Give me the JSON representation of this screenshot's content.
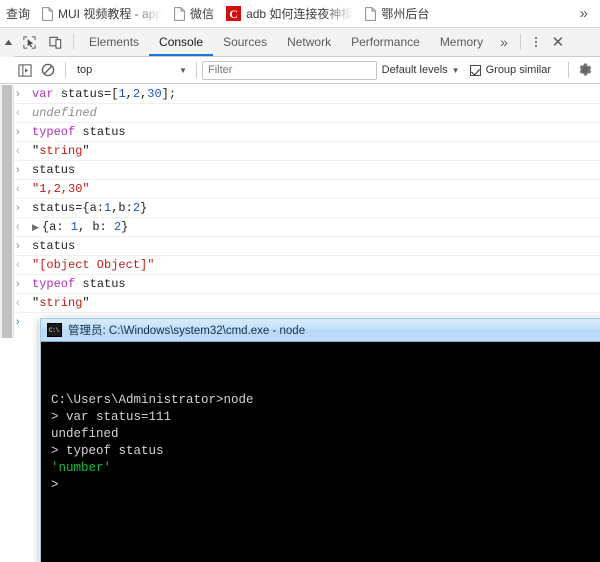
{
  "bookmarks_bar": {
    "items": [
      {
        "label": "查询",
        "icon": "none",
        "clipped": false
      },
      {
        "label": "MUI 视频教程 - app",
        "icon": "page-icon",
        "clipped": true
      },
      {
        "label": "微信",
        "icon": "page-icon",
        "clipped": false
      },
      {
        "label": "adb 如何连接夜神模",
        "icon": "c-letter-icon",
        "clipped": true
      },
      {
        "label": "鄂州后台",
        "icon": "page-icon",
        "clipped": false
      }
    ],
    "overflow_label": "»"
  },
  "devtools": {
    "toolbar": {
      "collapse_label": "▲",
      "inspect_icon": "inspect-element-icon",
      "device_icon": "device-toolbar-icon",
      "tabs": [
        {
          "label": "Elements",
          "active": false
        },
        {
          "label": "Console",
          "active": true
        },
        {
          "label": "Sources",
          "active": false
        },
        {
          "label": "Network",
          "active": false
        },
        {
          "label": "Performance",
          "active": false
        },
        {
          "label": "Memory",
          "active": false
        }
      ],
      "more_tabs_label": "»",
      "kebab_icon": "more-options-icon",
      "close_label": "✕"
    },
    "filterbar": {
      "sidebar_icon": "console-sidebar-icon",
      "clear_icon": "clear-console-icon",
      "context_value": "top",
      "context_caret": "▼",
      "filter_placeholder": "Filter",
      "filter_value": "",
      "levels_label": "Default levels",
      "levels_caret": "▼",
      "group_similar_label": "Group similar",
      "group_similar_checked": true,
      "settings_icon": "gear-icon"
    },
    "console_rows": [
      {
        "kind": "input",
        "marker": "›",
        "segments": [
          {
            "text": "var ",
            "style": "kw"
          },
          {
            "text": "status",
            "style": "plain"
          },
          {
            "text": "=[",
            "style": "plain"
          },
          {
            "text": "1",
            "style": "num"
          },
          {
            "text": ",",
            "style": "plain"
          },
          {
            "text": "2",
            "style": "num"
          },
          {
            "text": ",",
            "style": "plain"
          },
          {
            "text": "30",
            "style": "num"
          },
          {
            "text": "];",
            "style": "plain"
          }
        ]
      },
      {
        "kind": "output",
        "marker": "‹",
        "segments": [
          {
            "text": "undefined",
            "style": "undef"
          }
        ]
      },
      {
        "kind": "input",
        "marker": "›",
        "segments": [
          {
            "text": "typeof ",
            "style": "kw"
          },
          {
            "text": "status",
            "style": "plain"
          }
        ]
      },
      {
        "kind": "output",
        "marker": "‹",
        "segments": [
          {
            "text": "\"",
            "style": "plain"
          },
          {
            "text": "string",
            "style": "str"
          },
          {
            "text": "\"",
            "style": "plain"
          }
        ]
      },
      {
        "kind": "input",
        "marker": "›",
        "segments": [
          {
            "text": "status",
            "style": "plain"
          }
        ]
      },
      {
        "kind": "output",
        "marker": "‹",
        "segments": [
          {
            "text": "\"1,2,30\"",
            "style": "str"
          }
        ]
      },
      {
        "kind": "input",
        "marker": "›",
        "segments": [
          {
            "text": "status={a:",
            "style": "plain"
          },
          {
            "text": "1",
            "style": "num"
          },
          {
            "text": ",b:",
            "style": "plain"
          },
          {
            "text": "2",
            "style": "num"
          },
          {
            "text": "}",
            "style": "plain"
          }
        ]
      },
      {
        "kind": "output",
        "marker": "‹",
        "disclosure": "▶",
        "segments": [
          {
            "text": "{a: ",
            "style": "obj"
          },
          {
            "text": "1",
            "style": "num"
          },
          {
            "text": ", b: ",
            "style": "obj"
          },
          {
            "text": "2",
            "style": "num"
          },
          {
            "text": "}",
            "style": "obj"
          }
        ]
      },
      {
        "kind": "input",
        "marker": "›",
        "segments": [
          {
            "text": "status",
            "style": "plain"
          }
        ]
      },
      {
        "kind": "output",
        "marker": "‹",
        "segments": [
          {
            "text": "\"[object Object]\"",
            "style": "str"
          }
        ]
      },
      {
        "kind": "input",
        "marker": "›",
        "segments": [
          {
            "text": "typeof ",
            "style": "kw"
          },
          {
            "text": "status",
            "style": "plain"
          }
        ]
      },
      {
        "kind": "output",
        "marker": "‹",
        "segments": [
          {
            "text": "\"",
            "style": "plain"
          },
          {
            "text": "string",
            "style": "str"
          },
          {
            "text": "\"",
            "style": "plain"
          }
        ]
      }
    ],
    "prompt": {
      "caret": "›",
      "value": ""
    }
  },
  "cmd_window": {
    "title": "管理员: C:\\Windows\\system32\\cmd.exe - node",
    "icon": "cmd-console-icon",
    "lines": [
      {
        "text": "C:\\Users\\Administrator>node",
        "color": "white"
      },
      {
        "text": "> var status=111",
        "color": "white"
      },
      {
        "text": "undefined",
        "color": "white"
      },
      {
        "text": "> typeof status",
        "color": "white"
      },
      {
        "text": "'number'",
        "color": "green"
      },
      {
        "text": ">",
        "color": "white"
      }
    ]
  },
  "colors": {
    "tab_accent": "#1a73e8",
    "string_red": "#c41a16",
    "keyword_purple": "#aa33bb",
    "number_blue": "#1a56c4",
    "cmd_green": "#0fbd3f",
    "bookmark_red": "#d10f0f",
    "titlebar_blue": "#bfdefa"
  }
}
